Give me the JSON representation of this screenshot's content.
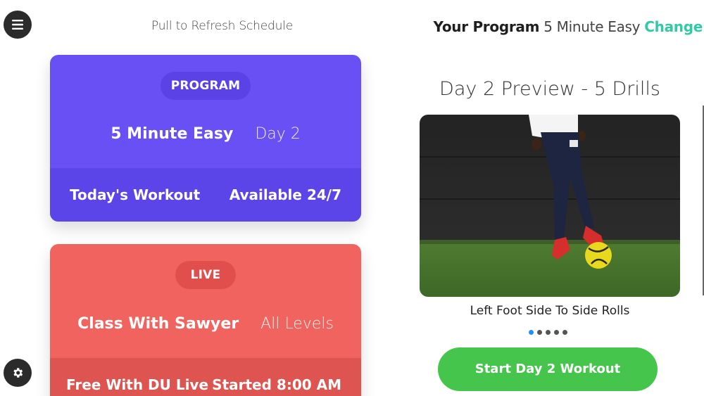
{
  "header": {
    "pull_to_refresh": "Pull to Refresh Schedule",
    "program_label": "Your Program",
    "program_value": "5 Minute Easy",
    "change_link": "Change"
  },
  "program_card": {
    "pill": "PROGRAM",
    "title": "5 Minute Easy",
    "subtitle": "Day 2",
    "footer_left": "Today's Workout",
    "footer_right": "Available 24/7",
    "color": "#6850f5"
  },
  "live_card": {
    "pill": "LIVE",
    "title": "Class With Sawyer",
    "subtitle": "All Levels",
    "footer_left": "Free With DU Live",
    "footer_right": "Started 8:00 AM",
    "color": "#f0635e"
  },
  "preview": {
    "title": "Day 2 Preview - 5 Drills",
    "drill_name": "Left Foot Side To Side Rolls",
    "page_count": 5,
    "active_page": 1,
    "start_button": "Start Day 2 Workout"
  },
  "icons": {
    "menu": "hamburger-menu-icon",
    "settings": "gear-icon"
  },
  "colors": {
    "accent": "#33c9a6",
    "start_button": "#45c54b",
    "active_dot": "#1e90ff"
  }
}
